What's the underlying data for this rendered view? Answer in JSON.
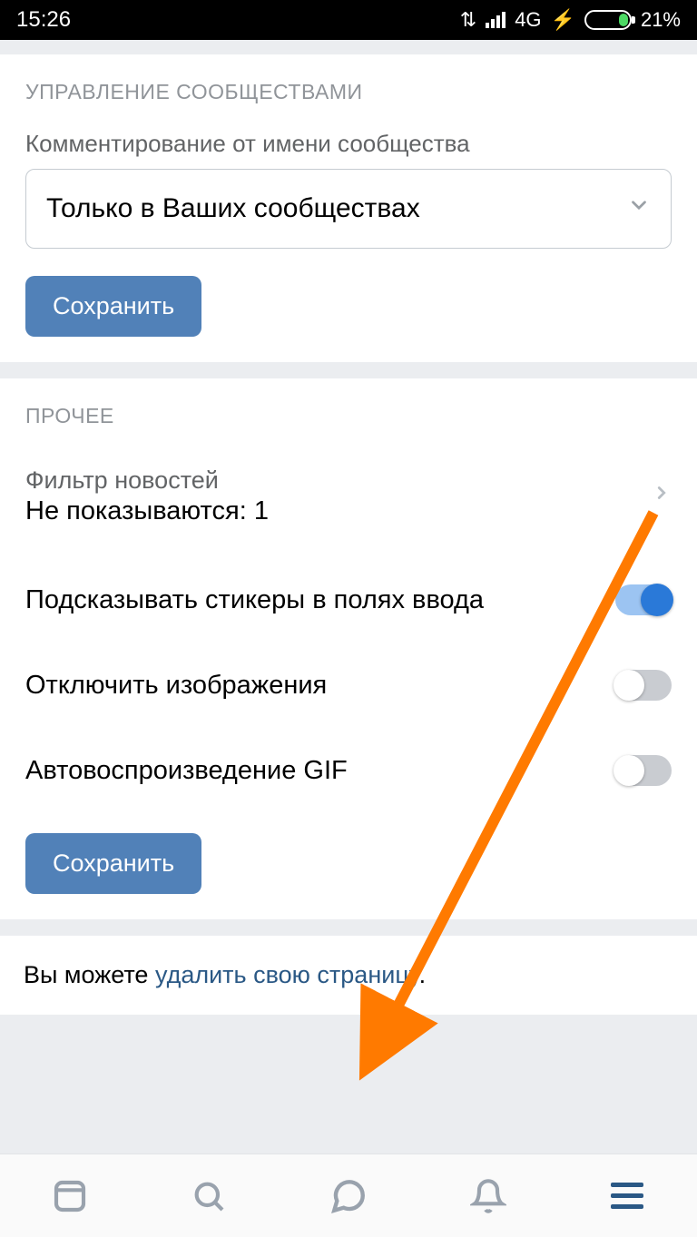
{
  "status": {
    "time": "15:26",
    "network": "4G",
    "battery_pct": "21%"
  },
  "section1": {
    "header": "УПРАВЛЕНИЕ СООБЩЕСТВАМИ",
    "field_label": "Комментирование от имени сообщества",
    "select_value": "Только в Ваших сообществах",
    "save": "Сохранить"
  },
  "section2": {
    "header": "ПРОЧЕЕ",
    "filter_label": "Фильтр новостей",
    "filter_value": "Не показываются: 1",
    "stickers_label": "Подсказывать стикеры в полях ввода",
    "images_label": "Отключить изображения",
    "gif_label": "Автовоспроизведение GIF",
    "save": "Сохранить"
  },
  "footer": {
    "prefix": "Вы можете ",
    "link": "удалить свою страницу",
    "suffix": "."
  }
}
